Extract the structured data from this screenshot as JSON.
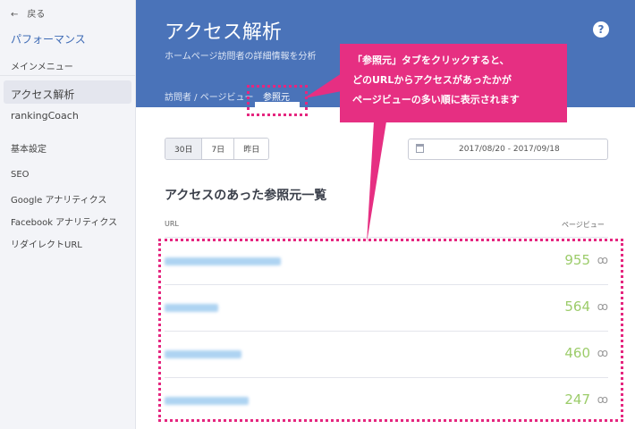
{
  "sidebar": {
    "back": "←　戻る",
    "section": "パフォーマンス",
    "main_menu": "メインメニュー",
    "items": [
      "アクセス解析",
      "rankingCoach"
    ],
    "basic": "基本設定",
    "settings": [
      "SEO",
      "Google アナリティクス",
      "Facebook アナリティクス",
      "リダイレクトURL"
    ]
  },
  "header": {
    "title": "アクセス解析",
    "subtitle": "ホームページ訪問者の詳細情報を分析",
    "help": "?",
    "tabs": [
      "訪問者 / ページビュー",
      "参照元"
    ]
  },
  "filters": {
    "ranges": [
      "30日",
      "7日",
      "昨日"
    ],
    "date_range": "2017/08/20 - 2017/09/18"
  },
  "table": {
    "title": "アクセスのあった参照元一覧",
    "col_url": "URL",
    "col_pv": "ページビュー",
    "rows": [
      {
        "pv": "955"
      },
      {
        "pv": "564"
      },
      {
        "pv": "460"
      },
      {
        "pv": "247"
      }
    ]
  },
  "callout": {
    "lines": [
      "「参照元」タブをクリックすると、",
      "どのURLからアクセスがあったかが",
      "ページビューの多い順に表示されます"
    ]
  },
  "colors": {
    "header": "#4a73b9",
    "accent": "#e62f82",
    "pv": "#9ccc6a"
  }
}
